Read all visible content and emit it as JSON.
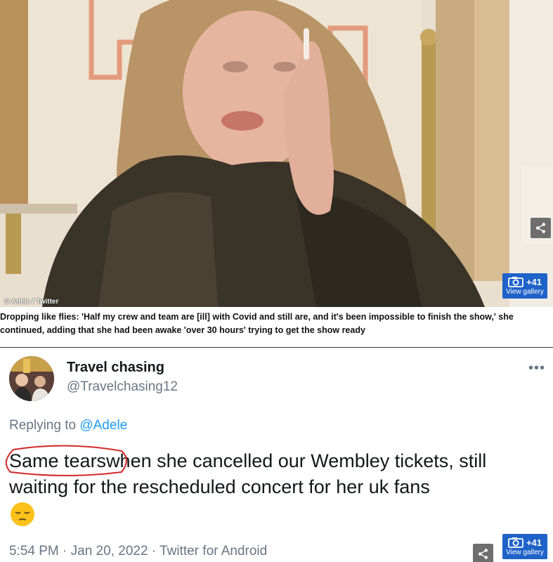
{
  "photo": {
    "credit": "© Adele / Twitter",
    "gallery": {
      "count": "+41",
      "label": "View gallery"
    },
    "icons": {
      "share": "share-icon",
      "camera": "camera-icon"
    }
  },
  "caption": "Dropping like flies: 'Half my crew and team are [ill] with Covid and still are, and it's been impossible to finish the show,' she continued, adding that she had been awake 'over 30 hours' trying to get the show ready",
  "tweet": {
    "display_name": "Travel chasing",
    "handle": "@Travelchasing12",
    "more": "•••",
    "replying_prefix": "Replying to",
    "replying_mention": "@Adele",
    "text_circled": "Same tears",
    "text_rest": "when she cancelled our  Wembley tickets, still waiting for the rescheduled concert for her uk fans",
    "emoji": "pensive-face-emoji",
    "timestamp": "5:54 PM · Jan 20, 2022 · Twitter for Android"
  },
  "footer": {
    "gallery": {
      "count": "+41",
      "label": "View gallery"
    }
  },
  "colors": {
    "gallery_blue": "#1f62c9",
    "share_gray": "#6e6e6e",
    "mention_blue": "#1d9bf0",
    "annotation_red": "#d42a2a",
    "muted_text": "#687684"
  }
}
